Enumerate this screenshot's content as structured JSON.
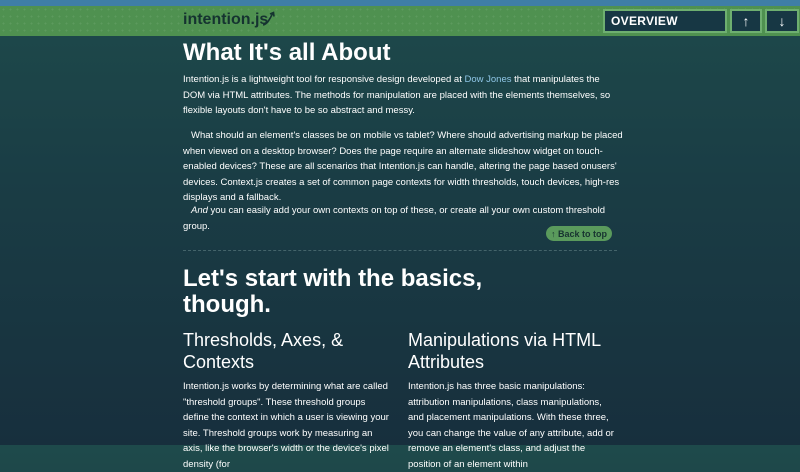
{
  "header": {
    "logo": "intention.js",
    "nav_overview": "OVERVIEW",
    "nav_up": "↑",
    "nav_down": "↓"
  },
  "about": {
    "title": "What It's all About",
    "p1_before": "Intention.js is a lightweight tool for responsive design developed at ",
    "p1_link": "Dow Jones",
    "p1_after": " that manipulates the DOM via HTML attributes. The methods for manipulation are placed with the elements themselves, so flexible layouts don't have to be so abstract and messy.",
    "p2": "What should an element's classes be on mobile vs tablet? Where should advertising markup be placed when viewed on a desktop browser? Does the page require an alternate slideshow widget on touch-enabled devices? These are all scenarios that Intention.js can handle, altering the page based onusers' devices. Context.js creates a set of common page contexts for width thresholds, touch devices, high-res displays and a fallback.",
    "p3_em": "And",
    "p3_rest": " you can easily add your own contexts on top of these, or create all your own custom threshold group.",
    "back_to_top": "↑ Back to top"
  },
  "basics": {
    "title": "Let's start with the basics, though.",
    "col1_title": "Thresholds, Axes, & Contexts",
    "col1_text": "Intention.js works by determining what are called \"threshold groups\". These threshold groups define the context in which a user is viewing your site. Threshold groups work by measuring an axis, like the browser's width or the device's pixel density (for",
    "col2_title": "Manipulations via HTML Attributes",
    "col2_text": "Intention.js has three basic manipulations: attribution manipulations, class manipulations, and placement manipulations. With these three, you can change the value of any attribute, add or remove an element's class, and adjust the position of an element within"
  }
}
